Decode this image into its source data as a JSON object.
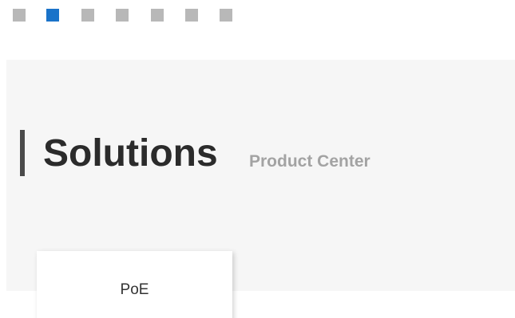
{
  "pager": {
    "count": 7,
    "active_index": 1,
    "colors": {
      "inactive": "#b8b8b8",
      "active": "#1a73c9"
    }
  },
  "section": {
    "title": "Solutions",
    "subtitle": "Product Center",
    "colors": {
      "title": "#2b2b2b",
      "subtitle": "#a3a3a3",
      "accent_bar": "#4a4a4a",
      "band": "#f6f6f6"
    }
  },
  "cards": [
    {
      "label": "PoE"
    }
  ]
}
